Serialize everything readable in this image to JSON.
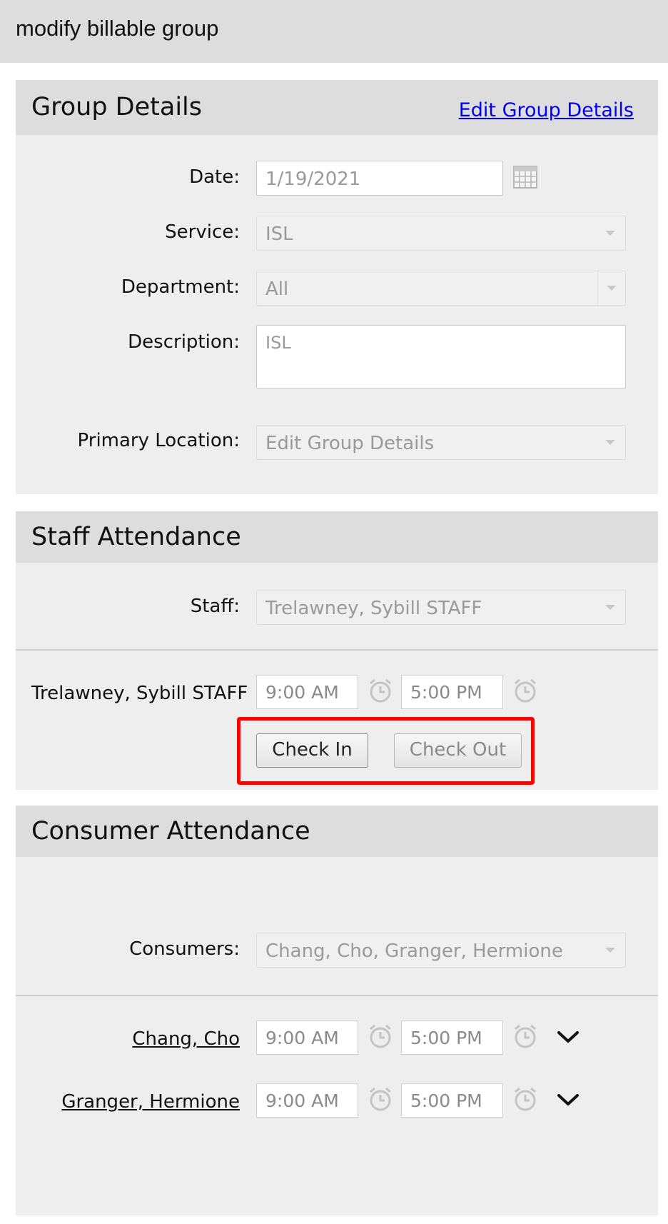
{
  "topbar": {
    "title": "modify billable group"
  },
  "group_details": {
    "title": "Group Details",
    "edit_link": "Edit Group Details",
    "date_label": "Date:",
    "date_value": "1/19/2021",
    "service_label": "Service:",
    "service_value": "ISL",
    "department_label": "Department:",
    "department_value": "All",
    "description_label": "Description:",
    "description_value": "ISL",
    "location_label": "Primary Location:",
    "location_value": "Edit Group Details"
  },
  "staff_attendance": {
    "title": "Staff Attendance",
    "staff_label": "Staff:",
    "staff_value": "Trelawney, Sybill STAFF",
    "row_name": "Trelawney, Sybill STAFF",
    "start_time": "9:00 AM",
    "end_time": "5:00 PM",
    "check_in_label": "Check In",
    "check_out_label": "Check Out"
  },
  "consumer_attendance": {
    "title": "Consumer Attendance",
    "consumers_label": "Consumers:",
    "consumers_value": "Chang, Cho, Granger, Hermione",
    "rows": [
      {
        "name": "Chang, Cho",
        "start_time": "9:00 AM",
        "end_time": "5:00 PM"
      },
      {
        "name": "Granger, Hermione",
        "start_time": "9:00 AM",
        "end_time": "5:00 PM"
      }
    ]
  },
  "colors": {
    "highlight": "#ff0000",
    "link": "#0000ee",
    "header_bg": "#dddddd",
    "panel_bg": "#eeeeee"
  }
}
